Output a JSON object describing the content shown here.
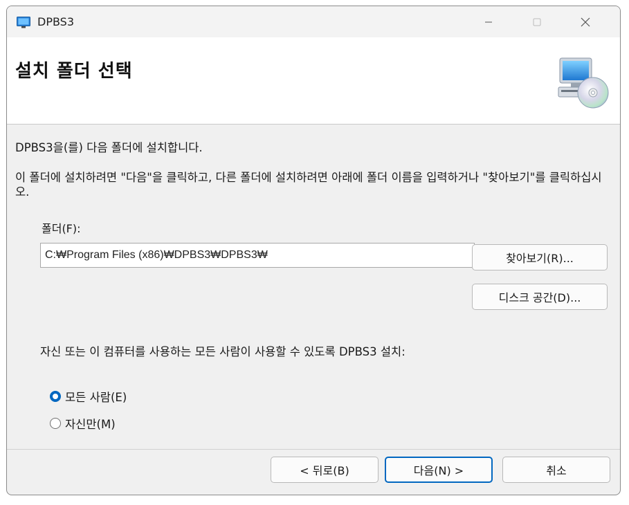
{
  "window": {
    "title": "DPBS3",
    "controls": {
      "minimize": "—",
      "maximize": "□",
      "close": "✕"
    }
  },
  "header": {
    "title": "설치 폴더 선택",
    "icon": "computer-cd-icon"
  },
  "content": {
    "line1": "DPBS3을(를) 다음 폴더에 설치합니다.",
    "line2": "이 폴더에 설치하려면 \"다음\"을 클릭하고, 다른 폴더에 설치하려면 아래에 폴더 이름을 입력하거나 \"찾아보기\"를 클릭하십시오."
  },
  "folder": {
    "label": "폴더(F):",
    "value": "C:₩Program Files (x86)₩DPBS3₩DPBS3₩"
  },
  "buttons": {
    "browse": "찾아보기(R)...",
    "disk_space": "디스크 공간(D)...",
    "back": "< 뒤로(B)",
    "next": "다음(N) >",
    "cancel": "취소"
  },
  "scope": {
    "text": "자신 또는 이 컴퓨터를 사용하는 모든 사람이 사용할 수 있도록 DPBS3 설치:",
    "options": [
      {
        "label": "모든 사람(E)",
        "selected": true
      },
      {
        "label": "자신만(M)",
        "selected": false
      }
    ]
  },
  "colors": {
    "accent": "#0067c0",
    "window_bg": "#f0f0f0",
    "header_bg": "#ffffff"
  }
}
